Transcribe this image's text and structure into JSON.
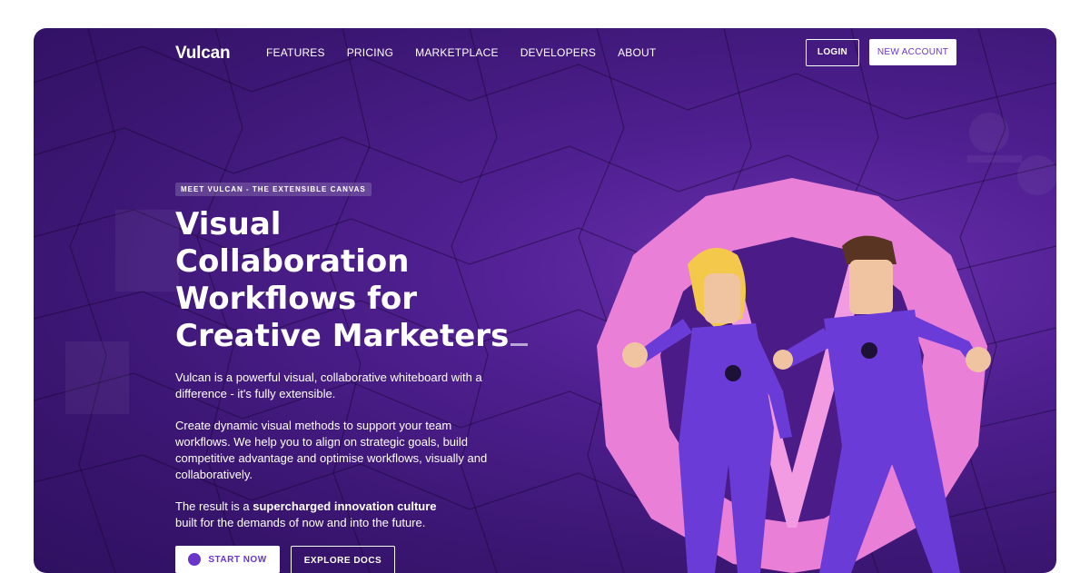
{
  "nav": {
    "logo": "Vulcan",
    "items": [
      "FEATURES",
      "PRICING",
      "MARKETPLACE",
      "DEVELOPERS",
      "ABOUT"
    ],
    "login": "LOGIN",
    "new_account": "NEW ACCOUNT"
  },
  "hero": {
    "badge": "MEET VULCAN - THE EXTENSIBLE CANVAS",
    "headline_lines": [
      "Visual",
      "Collaboration",
      "Workflows for",
      "Creative Marketers"
    ],
    "p1": "Vulcan is a powerful visual, collaborative whiteboard with a difference - it's fully extensible.",
    "p2": "Create dynamic visual methods to support your team workflows. We help you to align on strategic goals, build competitive advantage and optimise workflows, visually and collaboratively.",
    "p3_prefix": "The result is a ",
    "p3_bold": "supercharged innovation culture",
    "p3_suffix": "built for the demands of now and into the future.",
    "start_now": "START NOW",
    "explore_docs": "EXPLORE DOCS"
  },
  "colors": {
    "accent": "#6a36c9",
    "background": "#3b1672",
    "ring": "#e97fd6"
  }
}
